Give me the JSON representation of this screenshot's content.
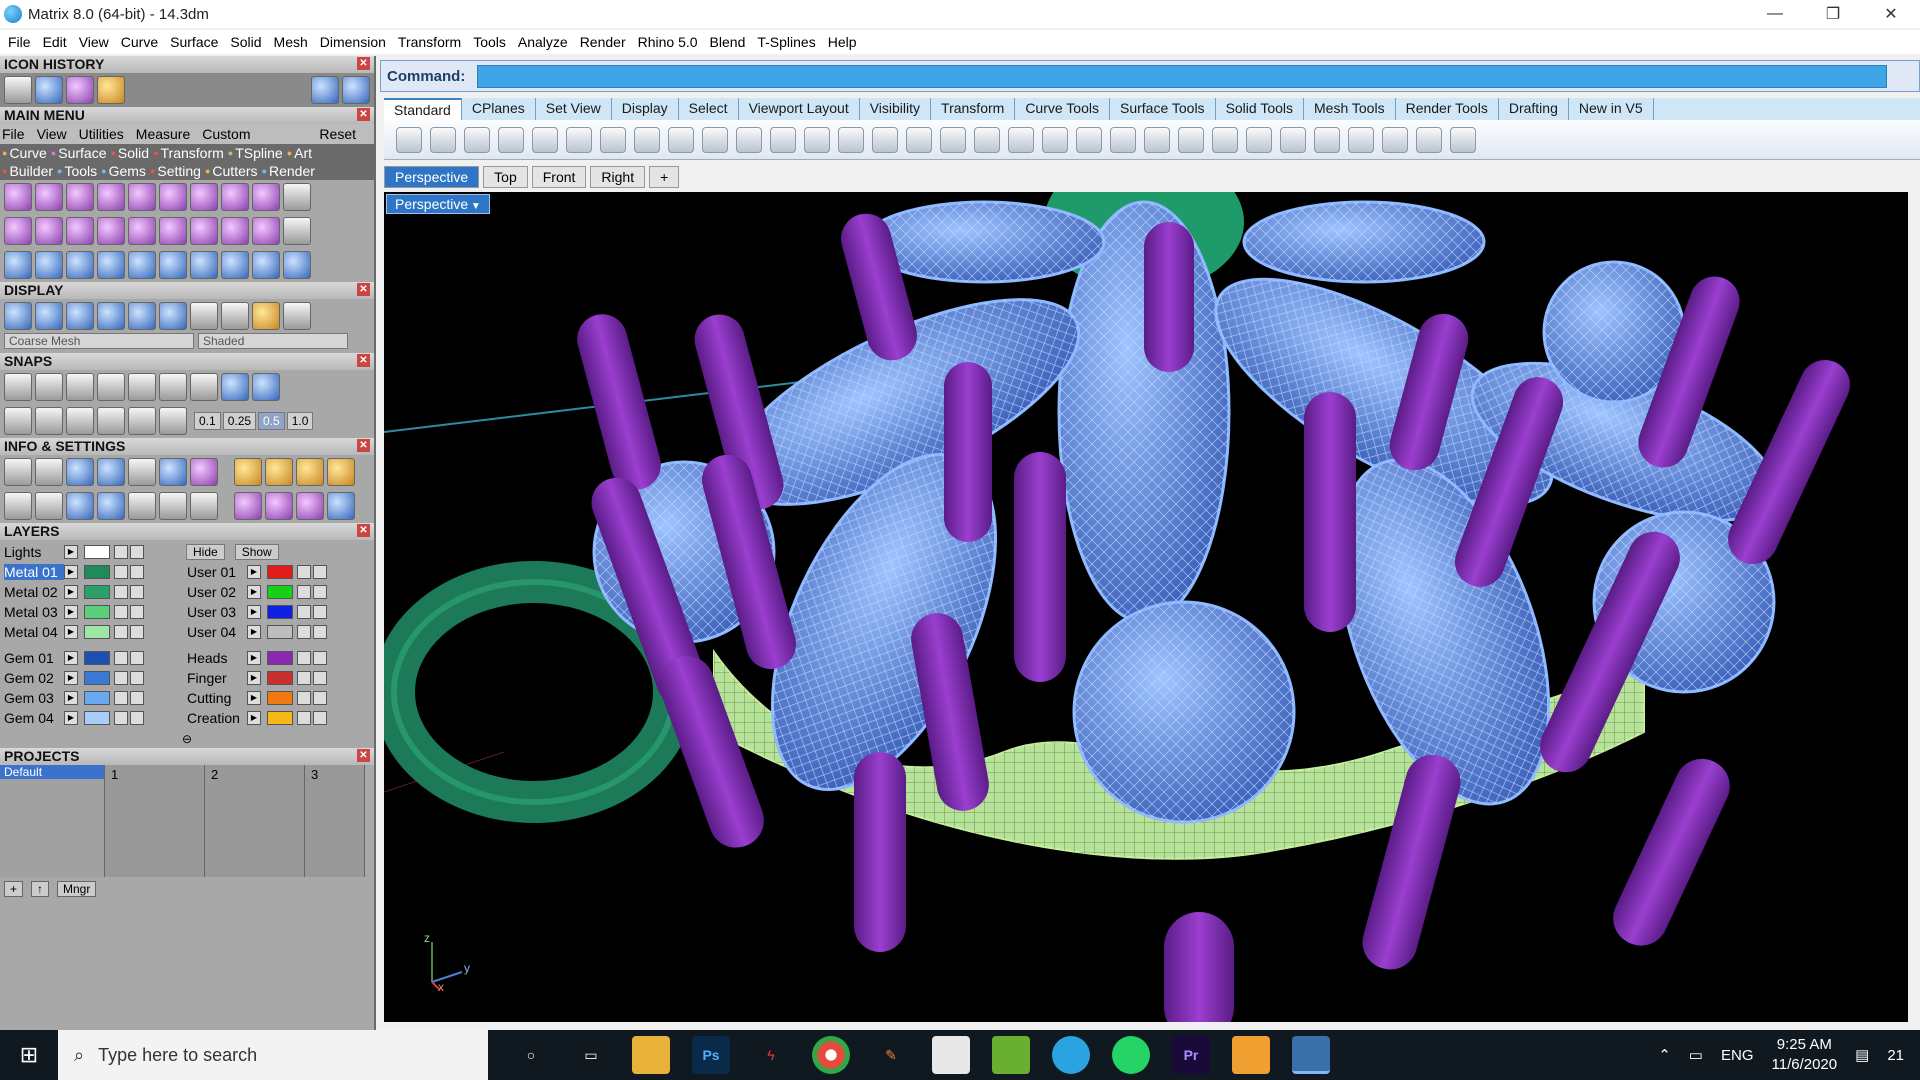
{
  "window": {
    "title": "Matrix 8.0 (64-bit) - 14.3dm"
  },
  "menubar": [
    "File",
    "Edit",
    "View",
    "Curve",
    "Surface",
    "Solid",
    "Mesh",
    "Dimension",
    "Transform",
    "Tools",
    "Analyze",
    "Render",
    "Rhino 5.0",
    "Blend",
    "T-Splines",
    "Help"
  ],
  "panels": {
    "icon_history": "ICON HISTORY",
    "main_menu": "MAIN MENU",
    "display": "DISPLAY",
    "snaps": "SNAPS",
    "info_settings": "INFO & SETTINGS",
    "layers": "LAYERS",
    "projects": "PROJECTS"
  },
  "main_menu": {
    "items": [
      "File",
      "View",
      "Utilities",
      "Measure",
      "Custom"
    ],
    "reset": "Reset",
    "tabs1": [
      "Curve",
      "Surface",
      "Solid",
      "Transform",
      "TSpline",
      "Art"
    ],
    "tabs2": [
      "Builder",
      "Tools",
      "Gems",
      "Setting",
      "Cutters",
      "Render"
    ]
  },
  "display": {
    "mesh": "Coarse Mesh",
    "mode": "Shaded"
  },
  "snaps": {
    "values": [
      "0.1",
      "0.25",
      "0.5",
      "1.0"
    ]
  },
  "layers": {
    "lights": "Lights",
    "hide": "Hide",
    "show": "Show",
    "left": [
      {
        "name": "Metal 01",
        "color": "#1f8a5a"
      },
      {
        "name": "Metal 02",
        "color": "#2aa06a"
      },
      {
        "name": "Metal 03",
        "color": "#58d07a"
      },
      {
        "name": "Metal 04",
        "color": "#9ee6a6"
      },
      {
        "name": "Gem 01",
        "color": "#1e4fb0"
      },
      {
        "name": "Gem 02",
        "color": "#3a7ad6"
      },
      {
        "name": "Gem 03",
        "color": "#6aa8f0"
      },
      {
        "name": "Gem 04",
        "color": "#a8cdf8"
      }
    ],
    "right": [
      {
        "name": "User 01",
        "color": "#e01b1b"
      },
      {
        "name": "User 02",
        "color": "#18d018"
      },
      {
        "name": "User 03",
        "color": "#1020e0"
      },
      {
        "name": "User 04",
        "color": "#bdbdbd"
      },
      {
        "name": "Heads",
        "color": "#8a28b4"
      },
      {
        "name": "Finger",
        "color": "#c83030"
      },
      {
        "name": "Cutting",
        "color": "#f07a10"
      },
      {
        "name": "Creation",
        "color": "#f5b818"
      }
    ]
  },
  "projects": {
    "default": "Default",
    "cols": [
      "1",
      "2",
      "3"
    ],
    "mngr": "Mngr"
  },
  "command": {
    "label": "Command:",
    "value": ""
  },
  "toolbar_tabs": [
    "Standard",
    "CPlanes",
    "Set View",
    "Display",
    "Select",
    "Viewport Layout",
    "Visibility",
    "Transform",
    "Curve Tools",
    "Surface Tools",
    "Solid Tools",
    "Mesh Tools",
    "Render Tools",
    "Drafting",
    "New in V5"
  ],
  "viewport_tabs": [
    "Perspective",
    "Top",
    "Front",
    "Right"
  ],
  "viewport_label": "Perspective",
  "axes": {
    "z": "z",
    "y": "y",
    "x": "x"
  },
  "taskbar": {
    "search_placeholder": "Type here to search",
    "apps": [
      "Ps",
      "Pr"
    ],
    "lang": "ENG",
    "time": "9:25 AM",
    "date": "11/6/2020",
    "notif": "21"
  }
}
